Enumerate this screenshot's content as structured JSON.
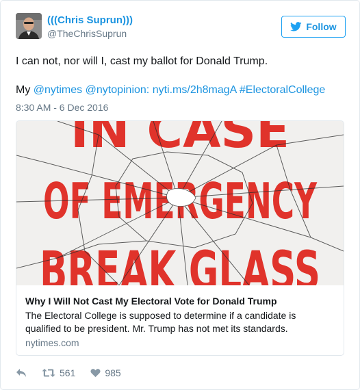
{
  "author": {
    "display_name": "(((Chris Suprun)))",
    "handle": "@TheChrisSuprun"
  },
  "follow_button": {
    "label": "Follow",
    "icon": "twitter-bird-icon"
  },
  "tweet": {
    "text_line1": "I can not, nor will I, cast my ballot for Donald Trump.",
    "text_prefix": "My",
    "mention1": "@nytimes",
    "mention2": "@nytopinion:",
    "link": "nyti.ms/2h8magA",
    "hashtag": "#ElectoralCollege",
    "timestamp": "8:30 AM - 6 Dec 2016"
  },
  "card": {
    "image_text": [
      "IN CASE",
      "OF EMERGENCY",
      "BREAK GLASS"
    ],
    "title": "Why I Will Not Cast My Electoral Vote for Donald Trump",
    "description": "The Electoral College is supposed to determine if a candidate is qualified to be president. Mr. Trump has not met its standards.",
    "domain": "nytimes.com"
  },
  "actions": {
    "reply_icon": "reply-icon",
    "retweet_count": "561",
    "like_count": "985"
  },
  "colors": {
    "accent": "#1c94e0",
    "muted": "#657786",
    "poster_red": "#e0332b"
  }
}
